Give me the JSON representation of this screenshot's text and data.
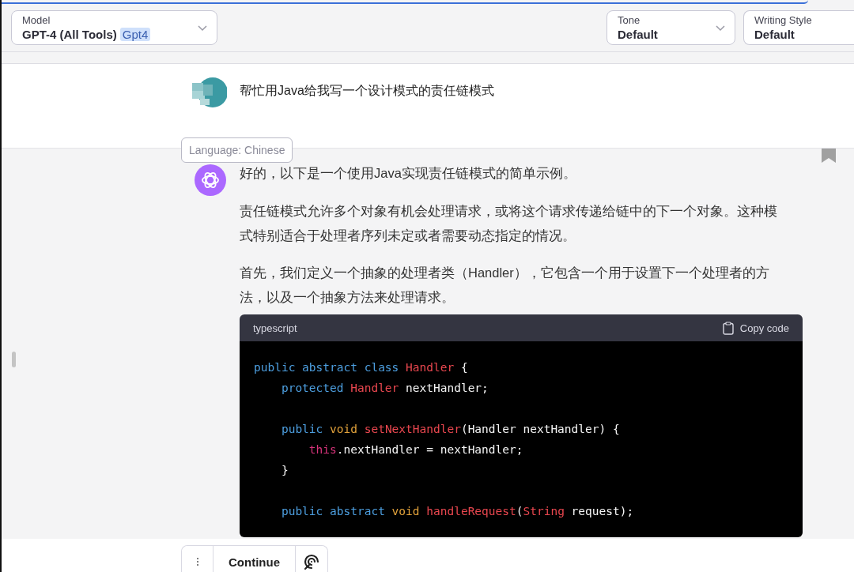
{
  "header": {
    "selects": [
      {
        "label": "Model",
        "value": "GPT-4 (All Tools)",
        "badge": "Gpt4",
        "kind": "model"
      },
      {
        "label": "Tone",
        "value": "Default",
        "kind": "plain"
      },
      {
        "label": "Writing Style",
        "value": "Default",
        "kind": "plain"
      }
    ]
  },
  "user_message": {
    "text": "帮忙用Java给我写一个设计模式的责任链模式"
  },
  "tooltip": "Language: Chinese",
  "assistant_message": {
    "paragraphs": [
      "好的，以下是一个使用Java实现责任链模式的简单示例。",
      "责任链模式允许多个对象有机会处理请求，或将这个请求传递给链中的下一个对象。这种模式特别适合于处理者序列未定或者需要动态指定的情况。",
      "首先，我们定义一个抽象的处理者类（Handler），它包含一个用于设置下一个处理者的方法，以及一个抽象方法来处理请求。"
    ],
    "code_block": {
      "language": "typescript",
      "copy_label": "Copy code",
      "lines": [
        {
          "kind": "code",
          "tokens": [
            {
              "text": "public abstract class ",
              "kind": "keyword"
            },
            {
              "text": "Handler",
              "kind": "type"
            },
            {
              "text": " {",
              "kind": "plain"
            }
          ]
        },
        {
          "kind": "code",
          "tokens": [
            {
              "text": "    protected ",
              "kind": "keyword"
            },
            {
              "text": "Handler",
              "kind": "type"
            },
            {
              "text": " nextHandler;",
              "kind": "plain"
            }
          ]
        },
        {
          "kind": "blank"
        },
        {
          "kind": "code",
          "tokens": [
            {
              "text": "    public ",
              "kind": "keyword"
            },
            {
              "text": "void ",
              "kind": "void"
            },
            {
              "text": "setNextHandler",
              "kind": "type"
            },
            {
              "text": "(Handler nextHandler) {",
              "kind": "plain"
            }
          ]
        },
        {
          "kind": "code",
          "tokens": [
            {
              "text": "        this",
              "kind": "this"
            },
            {
              "text": ".nextHandler = nextHandler;",
              "kind": "plain"
            }
          ]
        },
        {
          "kind": "code",
          "tokens": [
            {
              "text": "    }",
              "kind": "plain"
            }
          ]
        },
        {
          "kind": "blank"
        },
        {
          "kind": "code",
          "tokens": [
            {
              "text": "    public abstract ",
              "kind": "keyword"
            },
            {
              "text": "void ",
              "kind": "void"
            },
            {
              "text": "handleRequest",
              "kind": "type"
            },
            {
              "text": "(",
              "kind": "plain"
            },
            {
              "text": "String",
              "kind": "type"
            },
            {
              "text": " request);",
              "kind": "plain"
            }
          ]
        }
      ]
    }
  },
  "bottom_bar": {
    "button": "Continue"
  }
}
